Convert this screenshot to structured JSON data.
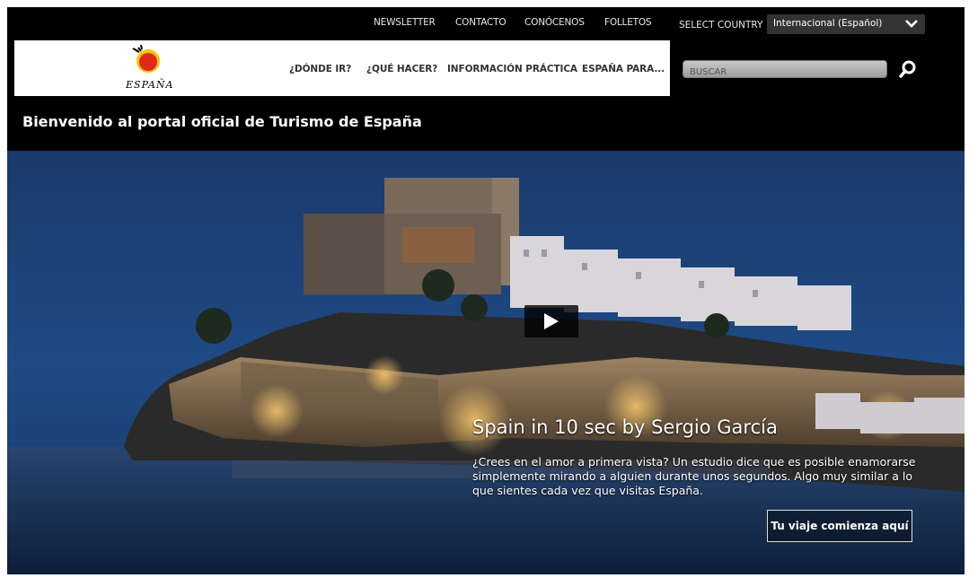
{
  "top_nav": {
    "links": [
      "NEWSLETTER",
      "CONTACTO",
      "CONÓCENOS",
      "FOLLETOS"
    ],
    "country_label": "SELECT COUNTRY",
    "country_value": "Internacional (Español)"
  },
  "logo": {
    "text": "ESPAÑA"
  },
  "main_nav": {
    "items": [
      "¿DÓNDE IR?",
      "¿QUÉ HACER?",
      "INFORMACIÓN PRÁCTICA",
      "ESPAÑA PARA..."
    ]
  },
  "search": {
    "placeholder": "BUSCAR"
  },
  "welcome": "Bienvenido al portal oficial de Turismo de España",
  "hero": {
    "title": "Spain in 10 sec by Sergio García",
    "description": "¿Crees en el amor a primera vista? Un estudio dice que es posible enamorarse simplemente mirando a alguien durante unos segundos. Algo muy similar a lo que sientes cada vez que visitas España.",
    "cta": "Tu viaje comienza aquí"
  },
  "colors": {
    "background": "#000000",
    "logo_sun_red": "#e0281b",
    "logo_sun_yellow": "#f6c400",
    "sky": "#1b3a6b"
  }
}
